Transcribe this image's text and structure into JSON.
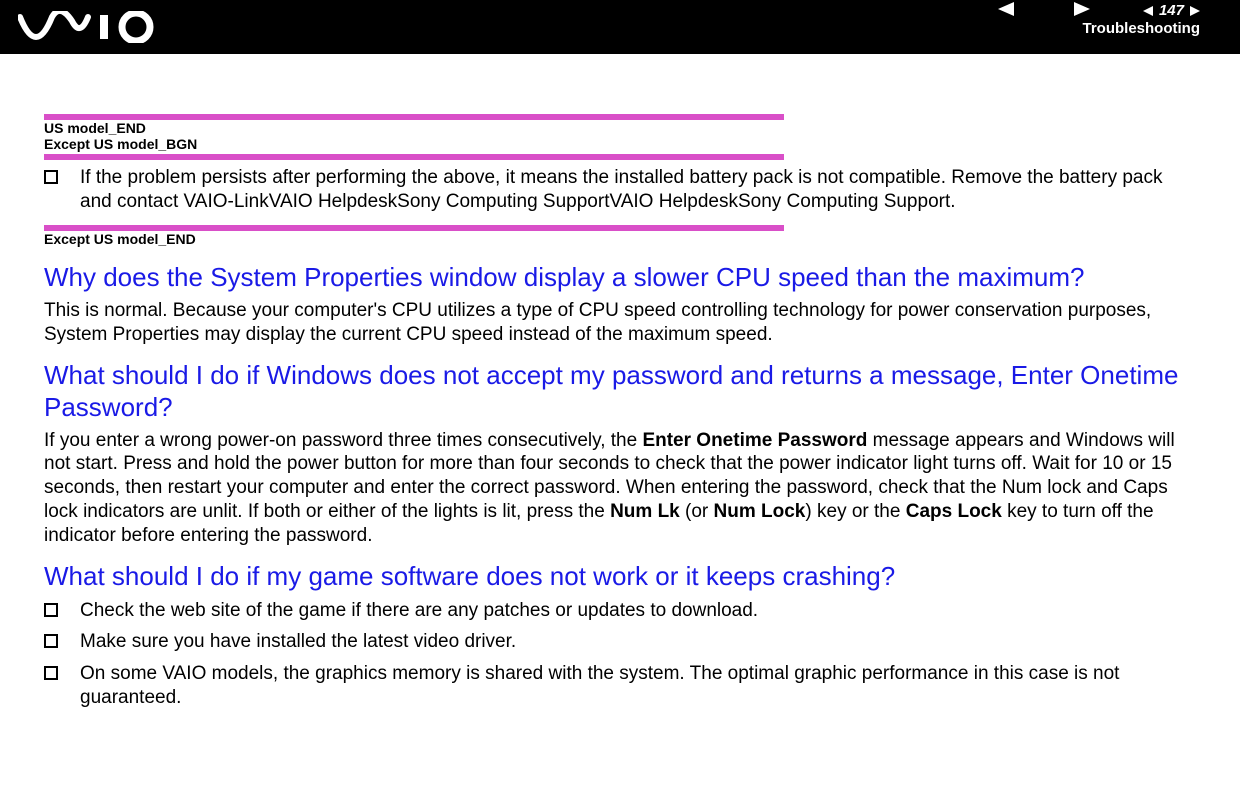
{
  "header": {
    "page_number": "147",
    "section": "Troubleshooting"
  },
  "marker1": {
    "line1": "US model_END",
    "line2": "Except US model_BGN"
  },
  "bullet1": "If the problem persists after performing the above, it means the installed battery pack is not compatible. Remove the battery pack and contact VAIO-LinkVAIO HelpdeskSony Computing SupportVAIO HelpdeskSony Computing Support.",
  "marker2": {
    "line1": "Except US model_END"
  },
  "q1": {
    "heading": "Why does the System Properties window display a slower CPU speed than the maximum?",
    "body": "This is normal. Because your computer's CPU utilizes a type of CPU speed controlling technology for power conservation purposes, System Properties may display the current CPU speed instead of the maximum speed."
  },
  "q2": {
    "heading": "What should I do if Windows does not accept my password and returns a message, Enter Onetime Password?",
    "body_pre": "If you enter a wrong power-on password three times consecutively, the ",
    "body_b1": "Enter Onetime Password",
    "body_mid1": " message appears and Windows will not start. Press and hold the power button for more than four seconds to check that the power indicator light turns off. Wait for 10 or 15 seconds, then restart your computer and enter the correct password. When entering the password, check that the Num lock and Caps lock indicators are unlit. If both or either of the lights is lit, press the ",
    "body_b2": "Num Lk",
    "body_mid2": " (or ",
    "body_b3": "Num Lock",
    "body_mid3": ") key or the ",
    "body_b4": "Caps Lock",
    "body_end": " key to turn off the indicator before entering the password."
  },
  "q3": {
    "heading": "What should I do if my game software does not work or it keeps crashing?",
    "bullets": [
      "Check the web site of the game if there are any patches or updates to download.",
      "Make sure you have installed the latest video driver.",
      "On some VAIO models, the graphics memory is shared with the system. The optimal graphic performance in this case is not guaranteed."
    ]
  }
}
